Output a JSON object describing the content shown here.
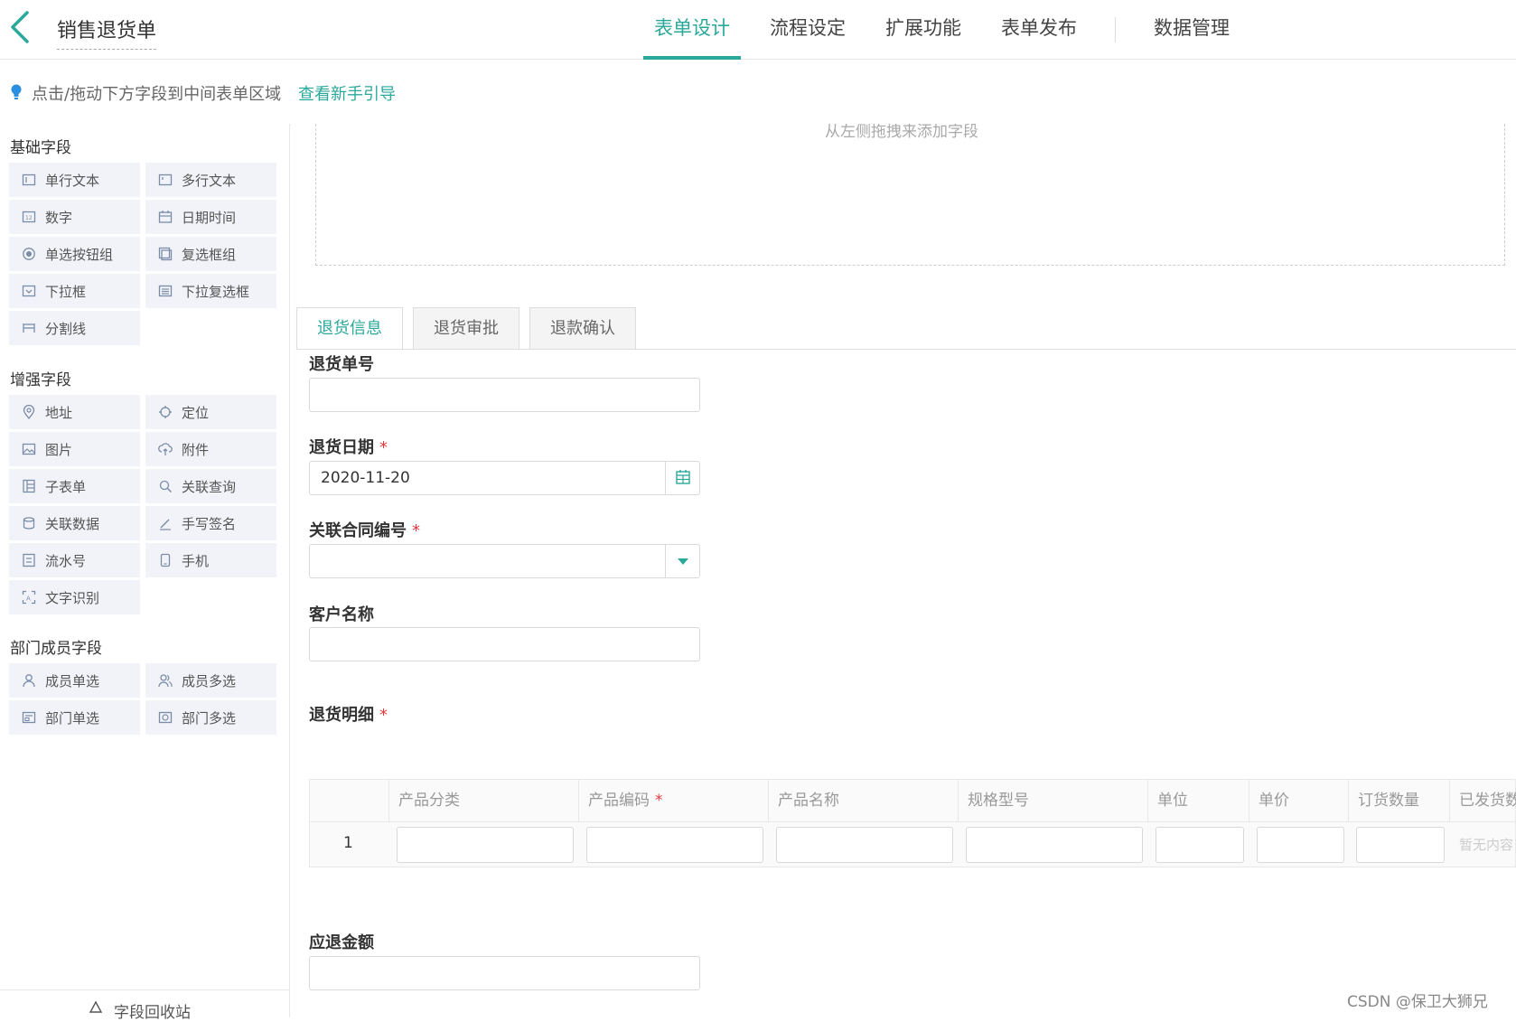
{
  "header": {
    "form_title": "销售退货单",
    "tabs": [
      "表单设计",
      "流程设定",
      "扩展功能",
      "表单发布",
      "数据管理"
    ],
    "active_tab": "表单设计",
    "accent_color": "#2aa89a"
  },
  "hint": {
    "text": "点击/拖动下方字段到中间表单区域",
    "link": "查看新手引导",
    "icon": "lightbulb-icon"
  },
  "sidebar": {
    "groups": [
      {
        "title": "基础字段",
        "items": [
          {
            "label": "单行文本",
            "icon": "single-line-text-icon"
          },
          {
            "label": "多行文本",
            "icon": "multi-line-text-icon"
          },
          {
            "label": "数字",
            "icon": "number-icon"
          },
          {
            "label": "日期时间",
            "icon": "datetime-icon"
          },
          {
            "label": "单选按钮组",
            "icon": "radio-icon"
          },
          {
            "label": "复选框组",
            "icon": "checkbox-icon"
          },
          {
            "label": "下拉框",
            "icon": "dropdown-icon"
          },
          {
            "label": "下拉复选框",
            "icon": "dropdown-multi-icon"
          },
          {
            "label": "分割线",
            "icon": "divider-icon"
          }
        ]
      },
      {
        "title": "增强字段",
        "items": [
          {
            "label": "地址",
            "icon": "address-icon"
          },
          {
            "label": "定位",
            "icon": "location-icon"
          },
          {
            "label": "图片",
            "icon": "image-icon"
          },
          {
            "label": "附件",
            "icon": "attachment-icon"
          },
          {
            "label": "子表单",
            "icon": "subform-icon"
          },
          {
            "label": "关联查询",
            "icon": "linked-query-icon"
          },
          {
            "label": "关联数据",
            "icon": "linked-data-icon"
          },
          {
            "label": "手写签名",
            "icon": "signature-icon"
          },
          {
            "label": "流水号",
            "icon": "serial-number-icon"
          },
          {
            "label": "手机",
            "icon": "phone-icon"
          },
          {
            "label": "文字识别",
            "icon": "ocr-icon"
          }
        ]
      },
      {
        "title": "部门成员字段",
        "items": [
          {
            "label": "成员单选",
            "icon": "member-single-icon"
          },
          {
            "label": "成员多选",
            "icon": "member-multi-icon"
          },
          {
            "label": "部门单选",
            "icon": "dept-single-icon"
          },
          {
            "label": "部门多选",
            "icon": "dept-multi-icon"
          }
        ]
      }
    ],
    "recycle_label": "字段回收站"
  },
  "canvas": {
    "dropzone_text": "从左侧拖拽来添加字段",
    "form_tabs": [
      "退货信息",
      "退货审批",
      "退款确认"
    ],
    "active_form_tab": "退货信息",
    "fields": {
      "return_no": {
        "label": "退货单号",
        "value": ""
      },
      "return_date": {
        "label": "退货日期",
        "value": "2020-11-20",
        "required": "*"
      },
      "contract_no": {
        "label": "关联合同编号",
        "value": "",
        "required": "*"
      },
      "customer": {
        "label": "客户名称",
        "value": ""
      },
      "detail": {
        "label": "退货明细",
        "required": "*"
      },
      "refund_amount": {
        "label": "应退金额",
        "value": ""
      }
    },
    "table": {
      "columns": [
        "产品分类",
        "产品编码",
        "产品名称",
        "规格型号",
        "单位",
        "单价",
        "订货数量",
        "已发货数"
      ],
      "required_column": "产品编码",
      "required_mark": "*",
      "row_number": "1",
      "no_content": "暂无内容"
    }
  },
  "watermark": "CSDN @保卫大狮兄"
}
